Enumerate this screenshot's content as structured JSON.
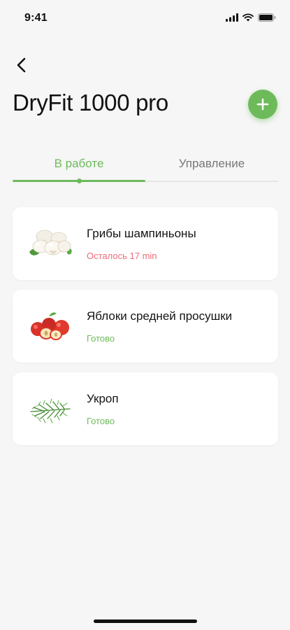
{
  "status_bar": {
    "time": "9:41"
  },
  "header": {
    "title": "DryFit 1000 pro"
  },
  "tabs": [
    {
      "label": "В работе"
    },
    {
      "label": "Управление"
    }
  ],
  "items": [
    {
      "title": "Грибы шампиньоны",
      "status": "Осталось 17 min",
      "status_color": "#ef6b7a",
      "image": "mushrooms"
    },
    {
      "title": "Яблоки средней просушки",
      "status": "Готово",
      "status_color": "#6dba5b",
      "image": "apples"
    },
    {
      "title": "Укроп",
      "status": "Готово",
      "status_color": "#6dba5b",
      "image": "dill"
    }
  ],
  "colors": {
    "accent": "#6dba5b",
    "warning": "#ef6b7a",
    "background": "#f6f6f6"
  }
}
